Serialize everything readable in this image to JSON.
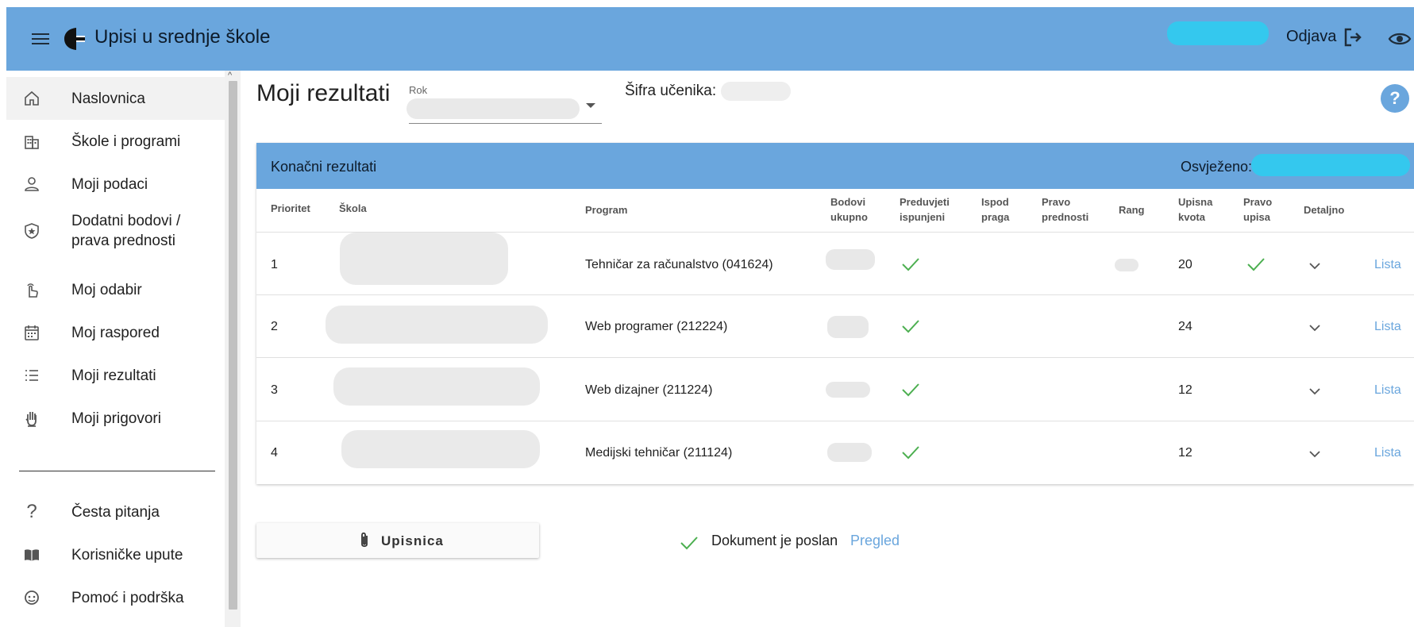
{
  "app": {
    "title": "Upisi u srednje škole",
    "logout_label": "Odjava",
    "accent_color": "#6aa6dd"
  },
  "sidebar": {
    "items": [
      {
        "label": "Naslovnica",
        "icon": "home-icon",
        "active": true
      },
      {
        "label": "Škole i programi",
        "icon": "building-icon"
      },
      {
        "label": "Moji podaci",
        "icon": "person-icon"
      },
      {
        "label": "Dodatni bodovi / prava prednosti",
        "icon": "shield-star-icon"
      },
      {
        "label": "Moj odabir",
        "icon": "pointer-hand-icon"
      },
      {
        "label": "Moj raspored",
        "icon": "calendar-icon"
      },
      {
        "label": "Moji rezultati",
        "icon": "list-icon"
      },
      {
        "label": "Moji prigovori",
        "icon": "hand-icon"
      }
    ],
    "footer_items": [
      {
        "label": "Česta pitanja",
        "icon": "question-icon"
      },
      {
        "label": "Korisničke upute",
        "icon": "book-icon"
      },
      {
        "label": "Pomoć i podrška",
        "icon": "support-icon"
      }
    ]
  },
  "main": {
    "title": "Moji rezultati",
    "rok_label": "Rok",
    "sifra_label": "Šifra učenika:",
    "help_label": "?"
  },
  "results": {
    "card_title": "Konačni rezultati",
    "refreshed_label": "Osvježeno:",
    "columns": [
      "Prioritet",
      "Škola",
      "Program",
      "Bodovi ukupno",
      "Preduvjeti ispunjeni",
      "Ispod praga",
      "Pravo prednosti",
      "Rang",
      "Upisna kvota",
      "Pravo upisa",
      "Detaljno"
    ],
    "rows": [
      {
        "priority": "1",
        "program": "Tehničar za računalstvo (041624)",
        "prerequisites_met": true,
        "quota": "20",
        "enrolled": true,
        "link": "Lista"
      },
      {
        "priority": "2",
        "program": "Web programer (212224)",
        "prerequisites_met": true,
        "quota": "24",
        "enrolled": false,
        "link": "Lista"
      },
      {
        "priority": "3",
        "program": "Web dizajner (211224)",
        "prerequisites_met": true,
        "quota": "12",
        "enrolled": false,
        "link": "Lista"
      },
      {
        "priority": "4",
        "program": "Medijski tehničar (211124)",
        "prerequisites_met": true,
        "quota": "12",
        "enrolled": false,
        "link": "Lista"
      }
    ]
  },
  "footer": {
    "upisnica_label": "Upisnica",
    "document_status": "Dokument je poslan",
    "preview_link": "Pregled",
    "check_color": "#4caf50"
  }
}
